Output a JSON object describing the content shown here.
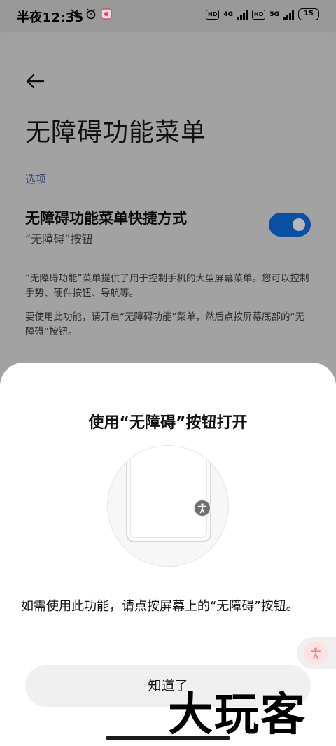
{
  "status_bar": {
    "time": "半夜12:35",
    "network_1": "4G",
    "network_2": "5G",
    "hd_label": "HD",
    "battery": "15"
  },
  "page": {
    "title": "无障碍功能菜单",
    "section_label": "选项",
    "shortcut_title": "无障碍功能菜单快捷方式",
    "shortcut_subtitle": "“无障碍”按钮",
    "toggle_on": true,
    "description_1": "“无障碍功能”菜单提供了用于控制手机的大型屏幕菜单。您可以控制手势、硬件按钮、导航等。",
    "description_2": "要使用此功能，请开启“无障碍功能”菜单，然后点按屏幕底部的“无障碍”按钮。"
  },
  "sheet": {
    "title": "使用“无障碍”按钮打开",
    "body": "如需使用此功能，请点按屏幕上的“无障碍”按钮。",
    "ok_label": "知道了"
  },
  "watermark": "大玩客",
  "colors": {
    "toggle_accent": "#0b4fa3",
    "sheet_bg": "#ffffff",
    "dim_bg": "#a2a2a2"
  },
  "icons": {
    "back": "arrow-left-icon",
    "accessibility": "accessibility-person-icon"
  }
}
